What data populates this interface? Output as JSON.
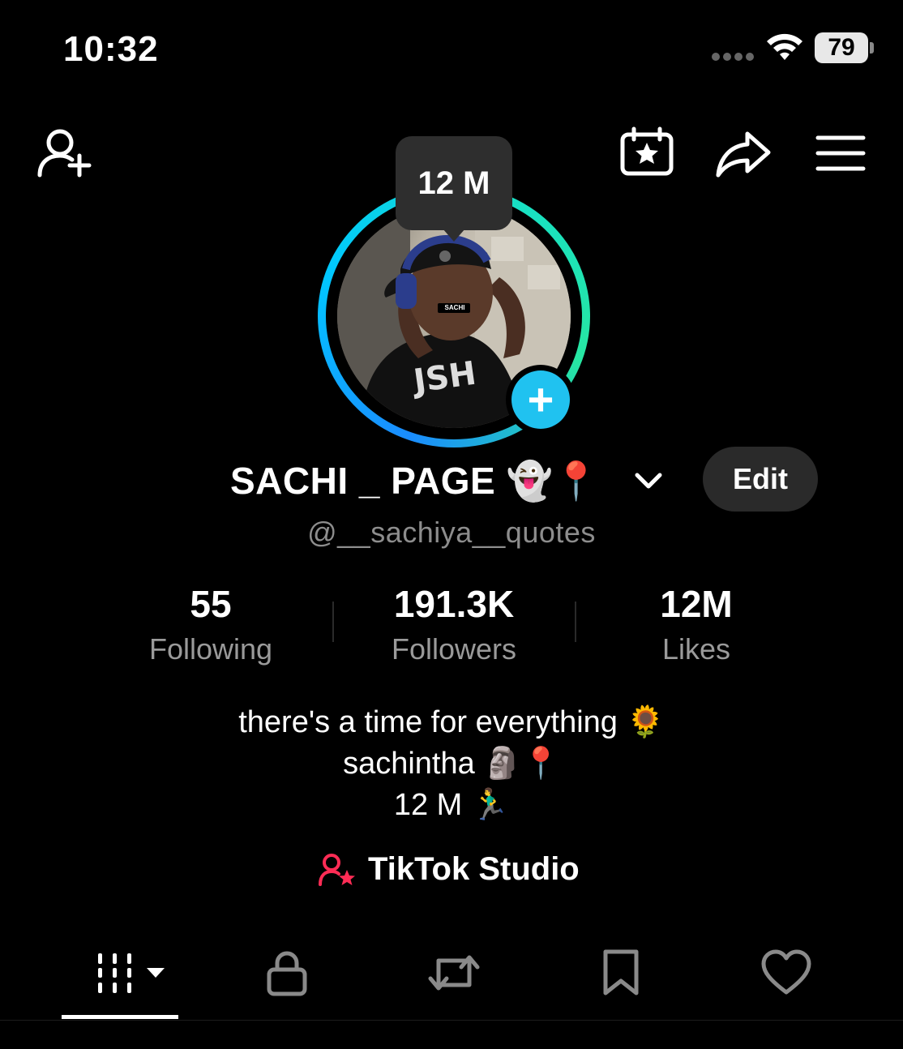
{
  "status_bar": {
    "time": "10:32",
    "battery": "79"
  },
  "top_bar": {
    "add_friend_icon": "person-plus-icon",
    "calendar_icon": "calendar-star-icon",
    "share_icon": "share-arrow-icon",
    "menu_icon": "hamburger-menu-icon"
  },
  "profile": {
    "avatar_tooltip": "12 M",
    "avatar_caption": "SACHI",
    "display_name": "SACHI _ PAGE 👻📍",
    "username": "@__sachiya__quotes",
    "edit_label": "Edit"
  },
  "stats": [
    {
      "value": "55",
      "label": "Following"
    },
    {
      "value": "191.3K",
      "label": "Followers"
    },
    {
      "value": "12M",
      "label": "Likes"
    }
  ],
  "bio": {
    "line1": "there's a time for everything 🌻",
    "line2": "sachintha 🗿📍",
    "line3": "12 M 🏃‍♂️"
  },
  "studio": {
    "label": "TikTok Studio"
  },
  "tabs": [
    {
      "icon": "grid-videos-icon",
      "active": true
    },
    {
      "icon": "lock-icon",
      "active": false
    },
    {
      "icon": "repost-icon",
      "active": false
    },
    {
      "icon": "bookmark-icon",
      "active": false
    },
    {
      "icon": "heart-icon",
      "active": false
    }
  ],
  "colors": {
    "background": "#000000",
    "accent_blue": "#20c2f0",
    "ring_start": "#1a8cff",
    "ring_end": "#27e6a2",
    "studio_icon": "#fe2c55",
    "muted_text": "#8d8d8d"
  }
}
